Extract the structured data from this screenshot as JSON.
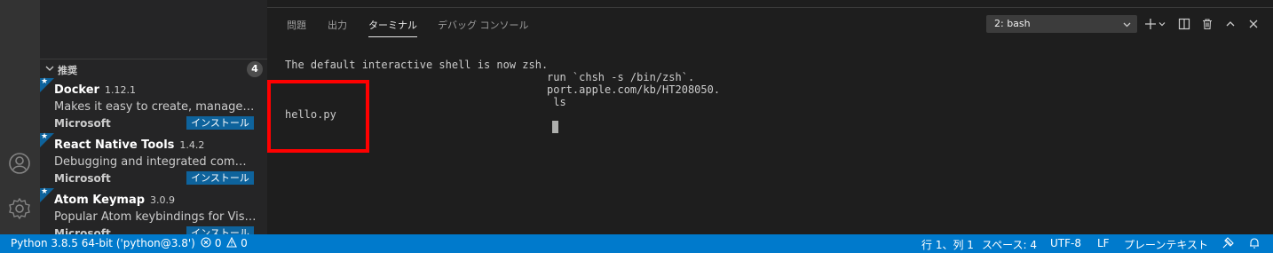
{
  "sidebar": {
    "section_title": "推奨",
    "section_count": "4",
    "extensions": [
      {
        "name": "Docker",
        "version": "1.12.1",
        "description": "Makes it easy to create, manage, and debug containerized applications.",
        "publisher": "Microsoft",
        "install_label": "インストール"
      },
      {
        "name": "React Native Tools",
        "version": "1.4.2",
        "description": "Debugging and integrated commands for React Native",
        "publisher": "Microsoft",
        "install_label": "インストール"
      },
      {
        "name": "Atom Keymap",
        "version": "3.0.9",
        "description": "Popular Atom keybindings for Visual Studio Code",
        "publisher": "Microsoft",
        "install_label": "インストール"
      }
    ]
  },
  "panel": {
    "tabs": [
      "問題",
      "出力",
      "ターミナル",
      "デバッグ コンソール"
    ],
    "active_tab": "ターミナル",
    "terminal_select": "2: bash",
    "terminal_lines": [
      "The default interactive shell is now zsh.",
      "run `chsh -s /bin/zsh`.",
      "port.apple.com/kb/HT208050.",
      " ls",
      "hello.py"
    ]
  },
  "status_bar": {
    "interpreter": "Python 3.8.5 64-bit ('python@3.8')",
    "errors": "0",
    "warnings": "0",
    "position": "行 1、列 1",
    "indent": "スペース: 4",
    "encoding": "UTF-8",
    "eol": "LF",
    "language": "プレーンテキスト"
  },
  "colors": {
    "status_bar_bg": "#007acc",
    "install_button_bg": "#0e639c",
    "highlight_border": "#ff0000",
    "panel_bg": "#1e1e1e",
    "sidebar_bg": "#252526"
  },
  "icons": [
    "account-icon",
    "gear-icon",
    "plus-icon",
    "split-icon",
    "trash-icon",
    "chevron-up-icon",
    "close-icon",
    "remote-icon",
    "bell-icon",
    "error-icon",
    "warning-icon",
    "star-icon"
  ]
}
